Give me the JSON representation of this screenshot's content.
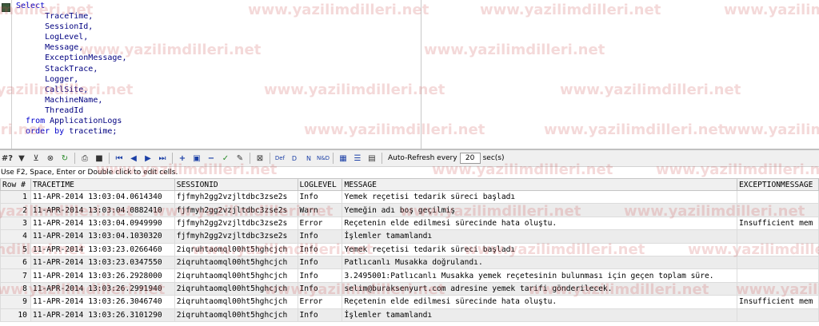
{
  "editor": {
    "lines": [
      {
        "kw": "Select",
        "rest": ""
      },
      {
        "kw": "",
        "rest": "      TraceTime,"
      },
      {
        "kw": "",
        "rest": "      SessionId,"
      },
      {
        "kw": "",
        "rest": "      LogLevel,"
      },
      {
        "kw": "",
        "rest": "      Message,"
      },
      {
        "kw": "",
        "rest": "      ExceptionMessage,"
      },
      {
        "kw": "",
        "rest": "      StackTrace,"
      },
      {
        "kw": "",
        "rest": "      Logger,"
      },
      {
        "kw": "",
        "rest": "      CallSite,"
      },
      {
        "kw": "",
        "rest": "      MachineName,"
      },
      {
        "kw": "",
        "rest": "      ThreadId"
      },
      {
        "kw": "  from",
        "rest": " ApplicationLogs"
      },
      {
        "kw": "  order by",
        "rest": " tracetime;"
      }
    ]
  },
  "toolbar": {
    "auto_refresh_label": "Auto-Refresh every",
    "auto_refresh_value": "20",
    "unit_label": "sec(s)",
    "icons": [
      "grid-menu-icon",
      "filter-icon",
      "filter-clear-icon",
      "cancel-icon",
      "refresh-icon",
      "print-icon",
      "save-icon",
      "first-record-icon",
      "prev-record-icon",
      "next-record-icon",
      "last-record-icon",
      "add-record-icon",
      "insert-record-icon",
      "delete-record-icon",
      "post-icon",
      "cancel-edit-icon",
      "clear-icon",
      "def-icon",
      "d-icon",
      "n-icon",
      "nd-icon",
      "grid-view-icon",
      "record-view-icon",
      "text-view-icon"
    ]
  },
  "hint": "Use F2, Space, Enter or Double click to edit cells.",
  "grid": {
    "columns": [
      "Row #",
      "TRACETIME",
      "SESSIONID",
      "LOGLEVEL",
      "MESSAGE",
      "EXCEPTIONMESSAGE"
    ],
    "rows": [
      [
        "1",
        "11-APR-2014 13:03:04.0614340",
        "fjfmyh2gg2vzjltdbc3zse2s",
        "Info",
        "Yemek reçetisi tedarik süreci başladı",
        ""
      ],
      [
        "2",
        "11-APR-2014 13:03:04.0882410",
        "fjfmyh2gg2vzjltdbc3zse2s",
        "Warn",
        "Yemeğin adı boş geçilmiş",
        ""
      ],
      [
        "3",
        "11-APR-2014 13:03:04.0949990",
        "fjfmyh2gg2vzjltdbc3zse2s",
        "Error",
        "Reçetenin elde edilmesi sürecinde hata oluştu.",
        "Insufficient mem"
      ],
      [
        "4",
        "11-APR-2014 13:03:04.1030320",
        "fjfmyh2gg2vzjltdbc3zse2s",
        "Info",
        "İşlemler tamamlandı",
        ""
      ],
      [
        "5",
        "11-APR-2014 13:03:23.0266460",
        "2iqruhtaomql00ht5hghcjch",
        "Info",
        "Yemek reçetisi tedarik süreci başladı",
        ""
      ],
      [
        "6",
        "11-APR-2014 13:03:23.0347550",
        "2iqruhtaomql00ht5hghcjch",
        "Info",
        "Patlıcanlı Musakka doğrulandı.",
        ""
      ],
      [
        "7",
        "11-APR-2014 13:03:26.2928000",
        "2iqruhtaomql00ht5hghcjch",
        "Info",
        "3.2495001:Patlıcanlı Musakka yemek reçetesinin bulunması için geçen toplam süre.",
        ""
      ],
      [
        "8",
        "11-APR-2014 13:03:26.2991940",
        "2iqruhtaomql00ht5hghcjch",
        "Info",
        "selim@buraksenyurt.com adresine yemek tarifi gönderilecek.",
        ""
      ],
      [
        "9",
        "11-APR-2014 13:03:26.3046740",
        "2iqruhtaomql00ht5hghcjch",
        "Error",
        "Reçetenin elde edilmesi sürecinde hata oluştu.",
        "Insufficient mem"
      ],
      [
        "10",
        "11-APR-2014 13:03:26.3101290",
        "2iqruhtaomql00ht5hghcjch",
        "Info",
        "İşlemler tamamlandı",
        ""
      ]
    ]
  },
  "watermark": "www.yazilimdilleri.net"
}
